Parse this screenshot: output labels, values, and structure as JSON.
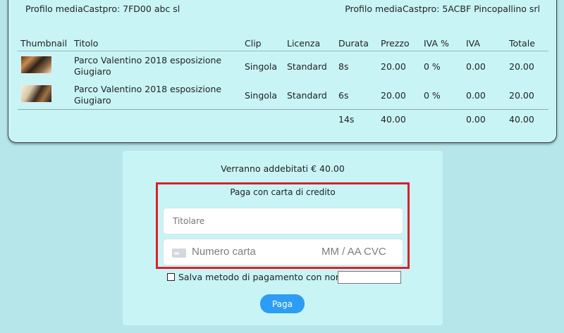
{
  "profiles": {
    "left": "Profilo mediaCastpro: 7FD00 abc sl",
    "right": "Profilo mediaCastpro: 5ACBF Pincopallino srl"
  },
  "table": {
    "headers": [
      "Thumbnail",
      "Titolo",
      "Clip",
      "Licenza",
      "Durata",
      "Prezzo",
      "IVA %",
      "IVA",
      "Totale"
    ],
    "rows": [
      {
        "title_line1": "Parco Valentino 2018 esposizione",
        "title_line2": "Giugiaro",
        "clip": "Singola",
        "license": "Standard",
        "duration": "8s",
        "price": "20.00",
        "vat_pct": "0 %",
        "vat": "0.00",
        "total": "20.00"
      },
      {
        "title_line1": "Parco Valentino 2018 esposizione",
        "title_line2": "Giugiaro",
        "clip": "Singola",
        "license": "Standard",
        "duration": "6s",
        "price": "20.00",
        "vat_pct": "0 %",
        "vat": "0.00",
        "total": "20.00"
      }
    ],
    "totals": {
      "duration": "14s",
      "price": "40.00",
      "vat": "0.00",
      "total": "40.00"
    }
  },
  "payment": {
    "charge_text": "Verranno addebitati € 40.00",
    "cc_title": "Paga con carta di credito",
    "holder_placeholder": "Titolare",
    "card_number_placeholder": "Numero carta",
    "card_exp_placeholder": "MM / AA CVC",
    "save_label": "Salva metodo di pagamento con nome",
    "pay_label": "Paga"
  },
  "colors": {
    "page_bg": "#b6e6ea",
    "card_bg": "#c8f4f6",
    "highlight_border": "#d6232d",
    "pay_button": "#2d9cf5"
  }
}
